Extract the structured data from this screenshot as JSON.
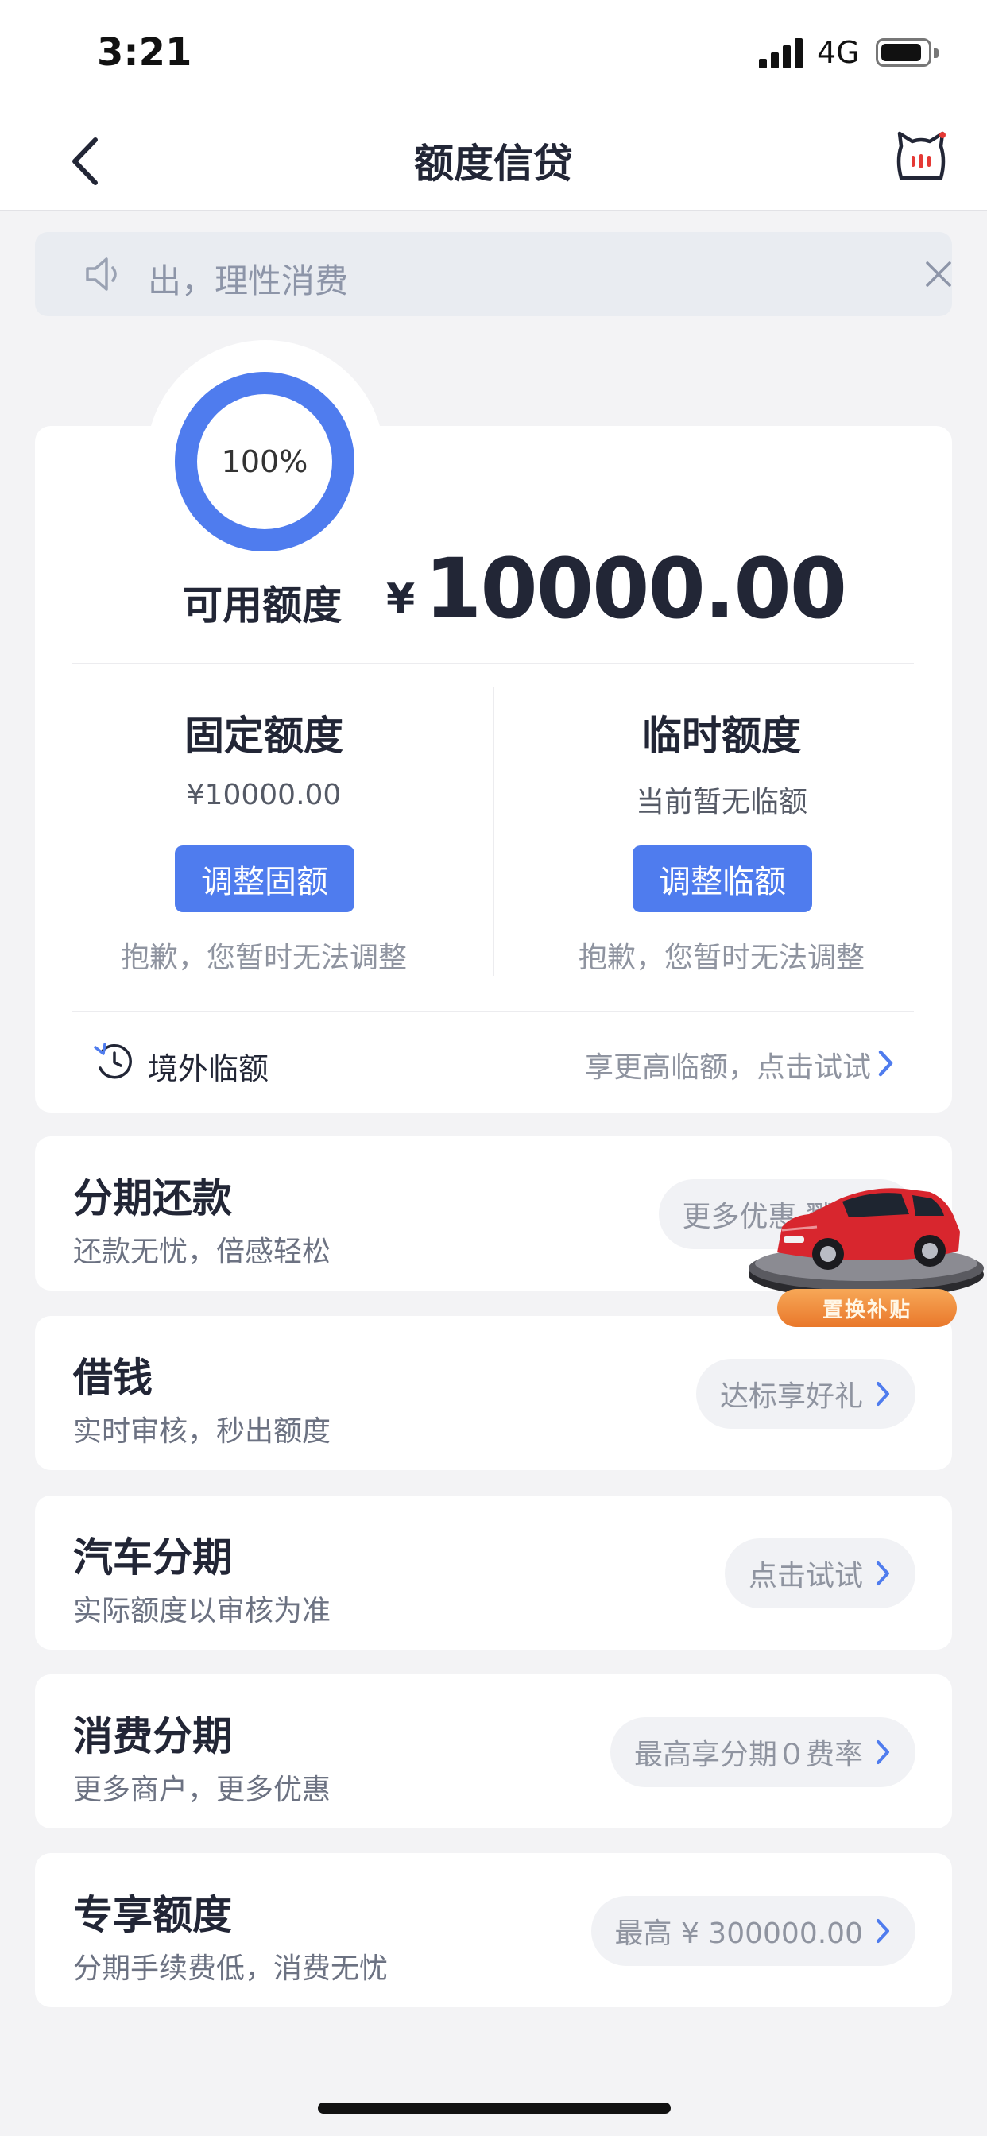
{
  "status_bar": {
    "time": "3:21",
    "network": "4G"
  },
  "nav": {
    "title": "额度信贷"
  },
  "notice": {
    "text": "出，理性消费"
  },
  "credit": {
    "ring_percent": "100%",
    "ring_fraction": 1.0,
    "available_label": "可用额度",
    "currency": "¥",
    "available_amount": "10000.00",
    "fixed": {
      "title": "固定额度",
      "value": "¥10000.00",
      "button": "调整固额",
      "note": "抱歉，您暂时无法调整"
    },
    "temporary": {
      "title": "临时额度",
      "value": "当前暂无临额",
      "button": "调整临额",
      "note": "抱歉，您暂时无法调整"
    },
    "overseas": {
      "label": "境外临额",
      "tip": "享更高临额，点击试试"
    }
  },
  "items": [
    {
      "title": "分期还款",
      "subtitle": "还款无忧，倍感轻松",
      "action": "更多优惠 戳我"
    },
    {
      "title": "借钱",
      "subtitle": "实时审核，秒出额度",
      "action": "达标享好礼"
    },
    {
      "title": "汽车分期",
      "subtitle": "实际额度以审核为准",
      "action": "点击试试"
    },
    {
      "title": "消费分期",
      "subtitle": "更多商户，更多优惠",
      "action": "最高享分期０费率"
    },
    {
      "title": "专享额度",
      "subtitle": "分期手续费低，消费无忧",
      "action": "最高 ¥ 300000.00"
    }
  ],
  "floating_ad": {
    "label": "置换补贴"
  },
  "colors": {
    "accent": "#4f7cee",
    "background": "#f3f3f5",
    "ad_orange": "#ee8433",
    "car_red": "#d8262e"
  }
}
